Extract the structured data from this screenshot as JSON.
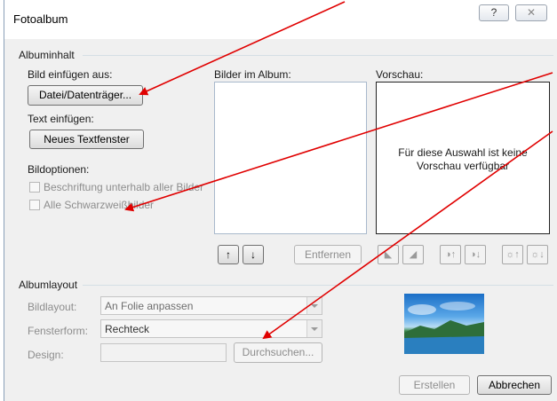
{
  "window": {
    "title": "Fotoalbum",
    "help_glyph": "?",
    "close_glyph": "✕"
  },
  "content_group": {
    "label": "Albuminhalt",
    "insert_picture_label": "Bild einfügen aus:",
    "file_button": "Datei/Datenträger...",
    "insert_text_label": "Text einfügen:",
    "new_textbox_button": "Neues Textfenster",
    "picture_options_label": "Bildoptionen:",
    "caption_option": "Beschriftung unterhalb aller Bilder",
    "bw_option": "Alle Schwarzweißbilder",
    "pictures_label": "Bilder im Album:",
    "preview_label": "Vorschau:",
    "preview_message": "Für diese Auswahl ist keine Vorschau verfügbar",
    "remove_button": "Entfernen",
    "move_up_glyph": "↑",
    "move_down_glyph": "↓"
  },
  "layout_group": {
    "label": "Albumlayout",
    "picture_layout_label": "Bildlayout:",
    "picture_layout_value": "An Folie anpassen",
    "frame_shape_label": "Fensterform:",
    "frame_shape_value": "Rechteck",
    "design_label": "Design:",
    "design_value": "",
    "browse_button": "Durchsuchen..."
  },
  "footer": {
    "create_button": "Erstellen",
    "cancel_button": "Abbrechen"
  },
  "icons": [
    "help-icon",
    "close-icon",
    "move-up-icon",
    "move-down-icon",
    "rotate-left-icon",
    "rotate-right-icon",
    "contrast-up-icon",
    "contrast-down-icon",
    "brightness-up-icon",
    "brightness-down-icon"
  ],
  "colors": {
    "arrow": "#e00000",
    "dialog_bg": "#f0f0f0"
  }
}
